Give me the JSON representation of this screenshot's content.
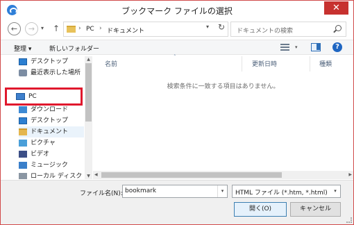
{
  "window": {
    "title": "ブックマーク ファイルの選択",
    "close_label": "✕"
  },
  "nav": {
    "breadcrumb": [
      "PC",
      "ドキュメント"
    ],
    "separator": "›",
    "search_placeholder": "ドキュメントの検索"
  },
  "toolbar": {
    "organize_label": "整理 ▾",
    "new_folder_label": "新しいフォルダー"
  },
  "sidebar": {
    "items": [
      {
        "label": "デスクトップ",
        "icon": "desktop-icon"
      },
      {
        "label": "最近表示した場所",
        "icon": "recent-places-icon"
      },
      {
        "label": "PC",
        "icon": "pc-icon"
      },
      {
        "label": "ダウンロード",
        "icon": "downloads-icon"
      },
      {
        "label": "デスクトップ",
        "icon": "desktop-icon"
      },
      {
        "label": "ドキュメント",
        "icon": "documents-icon"
      },
      {
        "label": "ピクチャ",
        "icon": "pictures-icon"
      },
      {
        "label": "ビデオ",
        "icon": "videos-icon"
      },
      {
        "label": "ミュージック",
        "icon": "music-icon"
      },
      {
        "label": "ローカル ディスク (C",
        "icon": "local-disk-icon"
      }
    ]
  },
  "list": {
    "columns": [
      "名前",
      "更新日時",
      "種類"
    ],
    "empty_message": "検索条件に一致する項目はありません。"
  },
  "footer": {
    "filename_label": "ファイル名(N):",
    "filename_value": "bookmark",
    "filetype_value": "HTML ファイル (*.htm, *.html)",
    "open_label": "開く(O)",
    "cancel_label": "キャンセル"
  },
  "colors": {
    "highlight_box": "#e0182d",
    "close_button": "#c7312f",
    "primary_button_border": "#3c7fb1"
  }
}
